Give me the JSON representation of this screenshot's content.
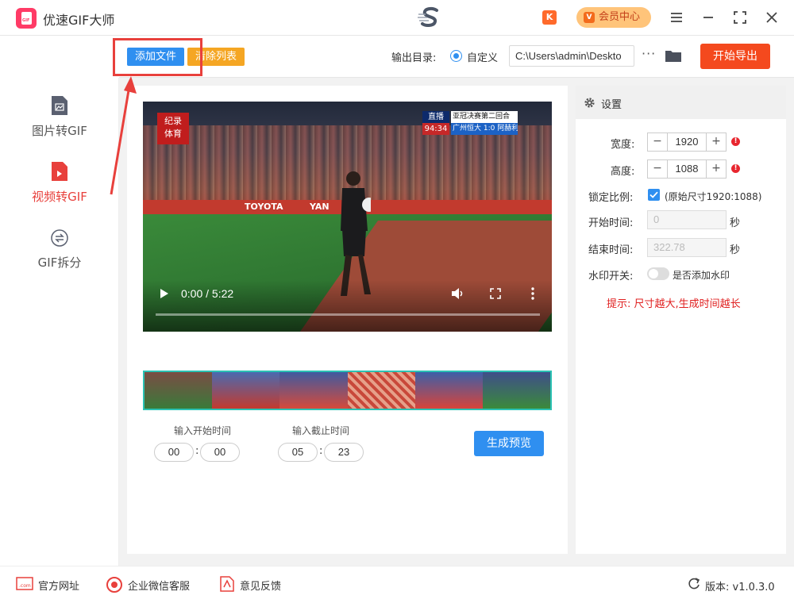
{
  "app": {
    "title": "优速GIF大师",
    "vip_label": "会员中心",
    "logo_badge": "GIF",
    "k_badge": "K"
  },
  "toolbar": {
    "add_file": "添加文件",
    "clear_list": "清除列表",
    "output_dir_label": "输出目录:",
    "custom_label": "自定义",
    "output_path": "C:\\Users\\admin\\Deskto",
    "more": "···",
    "export": "开始导出"
  },
  "sidebar": {
    "items": [
      {
        "label": "图片转GIF",
        "icon": "image-file-icon",
        "active": false
      },
      {
        "label": "视频转GIF",
        "icon": "video-file-icon",
        "active": true
      },
      {
        "label": "GIF拆分",
        "icon": "split-icon",
        "active": false
      }
    ]
  },
  "video": {
    "time": "0:00 / 5:22",
    "channel_logo": "纪录\n体育",
    "broadcast_live": "直播",
    "broadcast_clock": "94:34",
    "broadcast_match": "亚冠决赛第二回合",
    "broadcast_score": "广州恒大 1:0 阿赫利",
    "ad_text_1": "TOYOTA",
    "ad_text_2": "YAN"
  },
  "trim": {
    "start_label": "输入开始时间",
    "end_label": "输入截止时间",
    "start_min": "00",
    "start_sec": "00",
    "end_min": "05",
    "end_sec": "23",
    "colon": ":",
    "preview_button": "生成预览"
  },
  "settings": {
    "title": "设置",
    "width_label": "宽度:",
    "width_value": "1920",
    "height_label": "高度:",
    "height_value": "1088",
    "lock_label": "锁定比例:",
    "lock_note": "(原始尺寸1920:1088)",
    "lock_checked": true,
    "start_label": "开始时间:",
    "start_value": "0",
    "end_label": "结束时间:",
    "end_value": "322.78",
    "seconds_unit": "秒",
    "watermark_label": "水印开关:",
    "watermark_note": "是否添加水印",
    "watermark_enabled": false,
    "hint": "提示: 尺寸越大,生成时间越长",
    "minus": "−",
    "plus": "+",
    "warn": "!"
  },
  "footer": {
    "website": "官方网址",
    "wechat": "企业微信客服",
    "feedback": "意见反馈",
    "version": "版本: v1.0.3.0"
  },
  "colors": {
    "accent_blue": "#2f8ff0",
    "accent_orange": "#f5a623",
    "export_red": "#f4491e",
    "active_red": "#e8403c",
    "teal_border": "#2bc2b4"
  }
}
